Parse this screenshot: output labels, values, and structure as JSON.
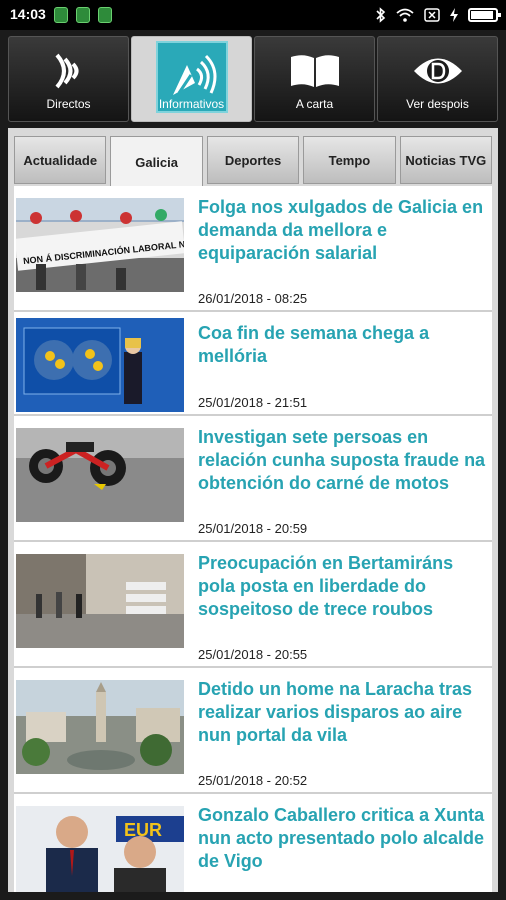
{
  "status": {
    "time": "14:03",
    "battery_level": 0.9
  },
  "main_tabs": [
    {
      "label": "Directos",
      "icon": "broadcast-icon",
      "active": false
    },
    {
      "label": "Informativos",
      "icon": "satellite-dish-icon",
      "active": true
    },
    {
      "label": "A carta",
      "icon": "open-book-icon",
      "active": false
    },
    {
      "label": "Ver despois",
      "icon": "d-eye-icon",
      "active": false
    }
  ],
  "sub_tabs": [
    {
      "label": "Actualidade",
      "active": false
    },
    {
      "label": "Galicia",
      "active": true
    },
    {
      "label": "Deportes",
      "active": false
    },
    {
      "label": "Tempo",
      "active": false
    },
    {
      "label": "Noticias TVG",
      "active": false
    }
  ],
  "news": [
    {
      "title": "Folga nos xulgados de Galicia en demanda da mellora e equiparación salarial",
      "date": "26/01/2018 - 08:25",
      "banner": "NON Á DISCRIMINACIÓN LABORAL NA XUSTIZA GALEGA!!!"
    },
    {
      "title": "Coa fin de semana chega a mellória",
      "date": "25/01/2018 - 21:51"
    },
    {
      "title": "Investigan sete persoas en relación cunha suposta fraude na obtención do carné de motos",
      "date": "25/01/2018 - 20:59"
    },
    {
      "title": "Preocupación en Bertamiráns pola posta en liberdade do sospeitoso de trece roubos",
      "date": "25/01/2018 - 20:55"
    },
    {
      "title": "Detido un home na Laracha tras realizar varios disparos ao aire nun portal da vila",
      "date": "25/01/2018 - 20:52"
    },
    {
      "title": "Gonzalo Caballero critica a Xunta nun acto presentado polo alcalde de Vigo",
      "date": "",
      "banner": "EUR"
    }
  ],
  "colors": {
    "accent": "#27a3b2",
    "active_tab_icon_bg": "#2aa9b8"
  }
}
